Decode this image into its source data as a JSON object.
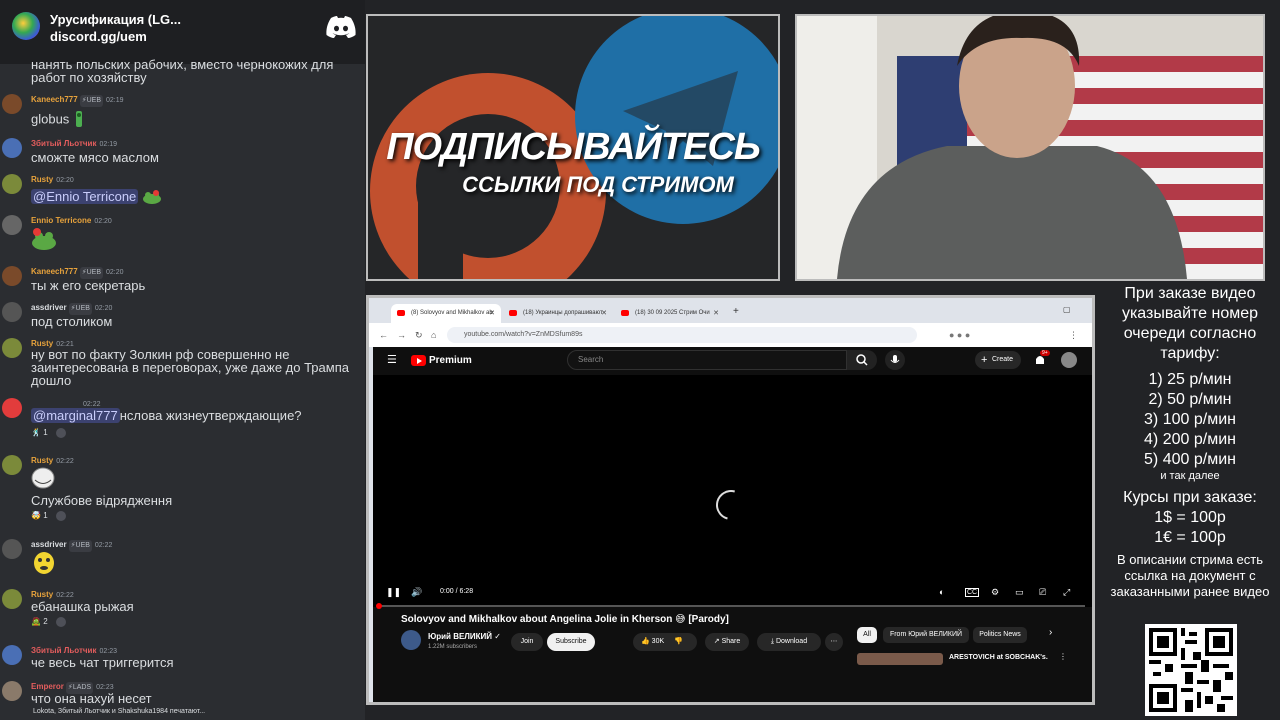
{
  "server": {
    "name": "Урусификация (LG...",
    "invite": "discord.gg/uem"
  },
  "chat": {
    "continued_text": "нанять польских рабочих, вместо чернокожих для работ по хозяйству",
    "messages": [
      {
        "user": "Kaneech777",
        "user_color": "#e8a33c",
        "badge": "⚡UEB",
        "time": "02:19",
        "text": "globus",
        "avatar_color": "#7a4a2a"
      },
      {
        "user": "Збитый Льотчик",
        "user_color": "#e35d5d",
        "badge": "",
        "time": "02:19",
        "text": "сможте мясо маслом",
        "avatar_color": "#4a6fb5"
      },
      {
        "user": "Rusty",
        "user_color": "#e8a33c",
        "badge": "",
        "time": "02:20",
        "mention": "@Ennio Terricone",
        "text": "",
        "avatar_color": "#7b8a3a"
      },
      {
        "user": "Ennio Terricone",
        "user_color": "#e8a33c",
        "badge": "",
        "time": "02:20",
        "text": "",
        "avatar_color": "#666666"
      },
      {
        "user": "Kaneech777",
        "user_color": "#e8a33c",
        "badge": "⚡UEB",
        "time": "02:20",
        "text": "ты ж его секретарь",
        "avatar_color": "#7a4a2a"
      },
      {
        "user": "assdriver",
        "user_color": "#dbdee1",
        "badge": "⚡UEB",
        "time": "02:20",
        "text": "под столиком",
        "avatar_color": "#555555"
      },
      {
        "user": "Rusty",
        "user_color": "#e8a33c",
        "badge": "",
        "time": "02:21",
        "text": "ну вот по факту Золкин рф совершенно не заинтересована в переговорах, уже даже до Трампа дошло",
        "avatar_color": "#7b8a3a"
      },
      {
        "user": "",
        "user_color": "#dbdee1",
        "badge": "",
        "time": "02:22",
        "mention": "@marginal777",
        "text": "нслова жизнеутверждающие?",
        "reaction": "1",
        "avatar_color": "#e23c3c"
      },
      {
        "user": "Rusty",
        "user_color": "#e8a33c",
        "badge": "",
        "time": "02:22",
        "text": "Службове відрядження",
        "reaction": "1",
        "avatar_color": "#7b8a3a"
      },
      {
        "user": "assdriver",
        "user_color": "#dbdee1",
        "badge": "⚡UEB",
        "time": "02:22",
        "text": "",
        "avatar_color": "#555555"
      },
      {
        "user": "Rusty",
        "user_color": "#e8a33c",
        "badge": "",
        "time": "02:22",
        "text": "ебанашка рыжая",
        "reaction": "2",
        "avatar_color": "#7b8a3a"
      },
      {
        "user": "Збитый Льотчик",
        "user_color": "#e35d5d",
        "badge": "",
        "time": "02:23",
        "text": "че весь чат триггерится",
        "avatar_color": "#4a6fb5"
      },
      {
        "user": "Emperor",
        "user_color": "#e35d5d",
        "badge": "⚡LADS",
        "time": "02:23",
        "text": "что она нахуй несет",
        "avatar_color": "#8a7a6a"
      }
    ],
    "typing": "Lokota, Збитый Льотчик и Shakshuka1984 печатают..."
  },
  "promo": {
    "title": "ПОДПИСЫВАЙТЕСЬ",
    "subtitle": "ССЫЛКИ ПОД СТРИМОМ"
  },
  "browser": {
    "tabs": [
      {
        "label": "(8) Solovyov and Mikhalkov ab",
        "active": true
      },
      {
        "label": "(18) Украинцы допрашивают",
        "active": false
      },
      {
        "label": "(18) 30 09 2025 Стрим Очи",
        "active": false
      }
    ],
    "url": "youtube.com/watch?v=ZnMDSfum89s"
  },
  "youtube": {
    "brand": "Premium",
    "search_placeholder": "Search",
    "create_label": "Create",
    "notif_count": "9+",
    "time": "0:00 / 6:28",
    "progress": 0.0,
    "video_title": "Solovyov and Mikhalkov about Angelina Jolie in Kherson 😅 [Parody]",
    "channel": "Юрий ВЕЛИКИЙ ✓",
    "subscribers": "1.22M subscribers",
    "join_label": "Join",
    "subscribe_label": "Subscribe",
    "likes": "30K",
    "share_label": "Share",
    "download_label": "Download",
    "chips": [
      "All",
      "From Юрий ВЕЛИКИЙ",
      "Politics News"
    ],
    "rec_title": "ARESTOVICH at SOBCHAK's."
  },
  "info": {
    "intro": "При заказе видео указывайте номер очереди согласно тарифу:",
    "tariffs": [
      "1) 25 р/мин",
      "2) 50 р/мин",
      "3) 100 р/мин",
      "4) 200 р/мин",
      "5) 400 р/мин"
    ],
    "etc": "и так далее",
    "rates_title": "Курсы при заказе:",
    "rates": [
      "1$ = 100р",
      "1€ = 100р"
    ],
    "description": "В описании стрима есть ссылка на документ с заказанными ранее видео"
  }
}
